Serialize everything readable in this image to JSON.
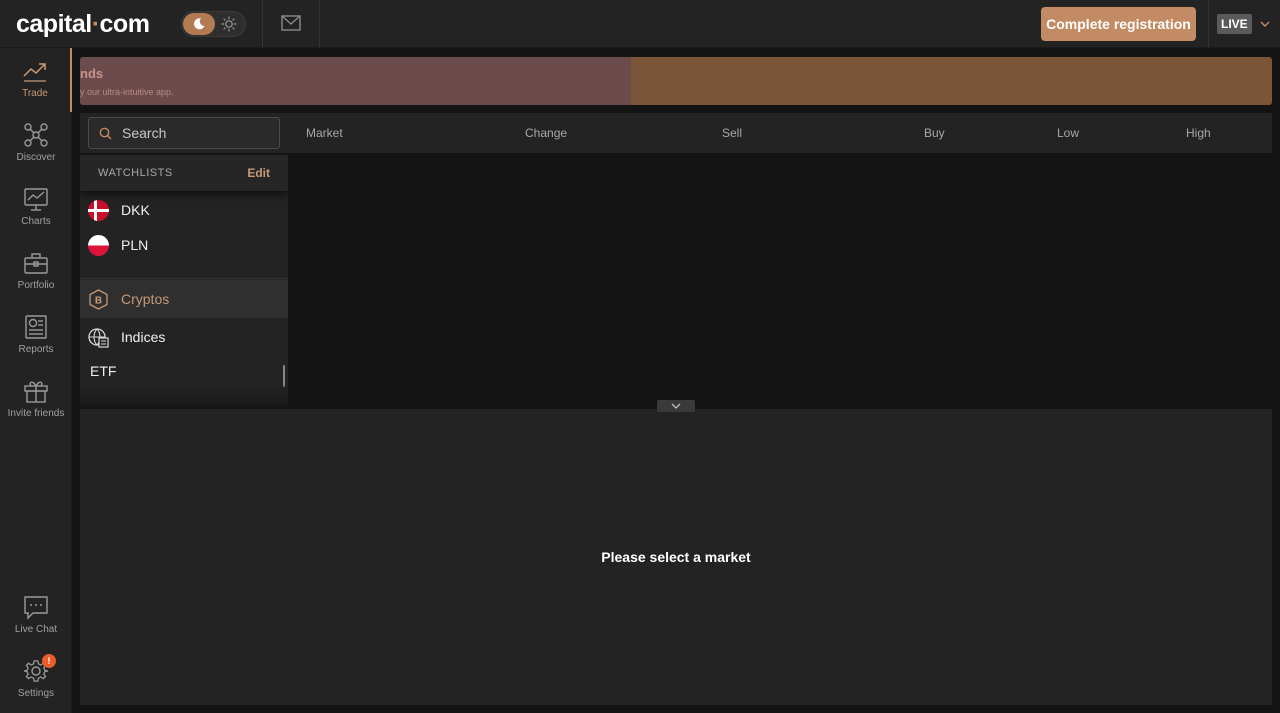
{
  "header": {
    "logo_text_1": "capital",
    "logo_dot": "·",
    "logo_text_2": "com",
    "cta_label": "Complete registration",
    "account_mode": "LIVE",
    "icons": [
      "moon-icon",
      "sun-icon",
      "mail-icon",
      "chevron-down-icon"
    ],
    "accent_color": "#c28b63"
  },
  "sidebar": {
    "items": [
      {
        "label": "Trade",
        "icon": "trend-icon",
        "active": true
      },
      {
        "label": "Discover",
        "icon": "network-icon"
      },
      {
        "label": "Charts",
        "icon": "chart-icon"
      },
      {
        "label": "Portfolio",
        "icon": "briefcase-icon"
      },
      {
        "label": "Reports",
        "icon": "report-icon"
      },
      {
        "label": "Invite friends",
        "icon": "gift-icon"
      }
    ],
    "bottom_items": [
      {
        "label": "Live Chat",
        "icon": "chat-icon"
      },
      {
        "label": "Settings",
        "icon": "gear-icon",
        "badge": "!"
      }
    ]
  },
  "banner": {
    "title": "nds",
    "subtitle": "y our ultra-intuitive app."
  },
  "market_header": {
    "search_placeholder": "Search",
    "columns": [
      "Market",
      "Change",
      "Sell",
      "Buy",
      "Low",
      "High"
    ]
  },
  "watchlists": {
    "title": "WATCHLISTS",
    "edit_label": "Edit",
    "currencies": [
      {
        "name": "DKK",
        "flag": "denmark"
      },
      {
        "name": "PLN",
        "flag": "poland"
      }
    ],
    "categories": [
      {
        "name": "Cryptos",
        "icon": "bitcoin-icon",
        "selected": true
      },
      {
        "name": "Indices",
        "icon": "globe-doc-icon"
      },
      {
        "name": "ETF",
        "icon": null
      }
    ]
  },
  "bottom_panel": {
    "message": "Please select a market"
  }
}
